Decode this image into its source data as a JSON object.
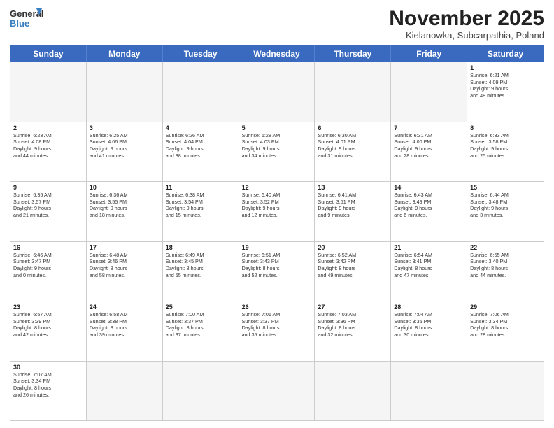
{
  "logo": {
    "line1": "General",
    "line2": "Blue"
  },
  "title": "November 2025",
  "subtitle": "Kielanowka, Subcarpathia, Poland",
  "header_days": [
    "Sunday",
    "Monday",
    "Tuesday",
    "Wednesday",
    "Thursday",
    "Friday",
    "Saturday"
  ],
  "weeks": [
    [
      {
        "day": "",
        "info": "",
        "empty": true
      },
      {
        "day": "",
        "info": "",
        "empty": true
      },
      {
        "day": "",
        "info": "",
        "empty": true
      },
      {
        "day": "",
        "info": "",
        "empty": true
      },
      {
        "day": "",
        "info": "",
        "empty": true
      },
      {
        "day": "",
        "info": "",
        "empty": true
      },
      {
        "day": "1",
        "info": "Sunrise: 6:21 AM\nSunset: 4:09 PM\nDaylight: 9 hours\nand 48 minutes.",
        "empty": false
      }
    ],
    [
      {
        "day": "2",
        "info": "Sunrise: 6:23 AM\nSunset: 4:08 PM\nDaylight: 9 hours\nand 44 minutes.",
        "empty": false
      },
      {
        "day": "3",
        "info": "Sunrise: 6:25 AM\nSunset: 4:06 PM\nDaylight: 9 hours\nand 41 minutes.",
        "empty": false
      },
      {
        "day": "4",
        "info": "Sunrise: 6:26 AM\nSunset: 4:04 PM\nDaylight: 9 hours\nand 38 minutes.",
        "empty": false
      },
      {
        "day": "5",
        "info": "Sunrise: 6:28 AM\nSunset: 4:03 PM\nDaylight: 9 hours\nand 34 minutes.",
        "empty": false
      },
      {
        "day": "6",
        "info": "Sunrise: 6:30 AM\nSunset: 4:01 PM\nDaylight: 9 hours\nand 31 minutes.",
        "empty": false
      },
      {
        "day": "7",
        "info": "Sunrise: 6:31 AM\nSunset: 4:00 PM\nDaylight: 9 hours\nand 28 minutes.",
        "empty": false
      },
      {
        "day": "8",
        "info": "Sunrise: 6:33 AM\nSunset: 3:58 PM\nDaylight: 9 hours\nand 25 minutes.",
        "empty": false
      }
    ],
    [
      {
        "day": "9",
        "info": "Sunrise: 6:35 AM\nSunset: 3:57 PM\nDaylight: 9 hours\nand 21 minutes.",
        "empty": false
      },
      {
        "day": "10",
        "info": "Sunrise: 6:36 AM\nSunset: 3:55 PM\nDaylight: 9 hours\nand 18 minutes.",
        "empty": false
      },
      {
        "day": "11",
        "info": "Sunrise: 6:38 AM\nSunset: 3:54 PM\nDaylight: 9 hours\nand 15 minutes.",
        "empty": false
      },
      {
        "day": "12",
        "info": "Sunrise: 6:40 AM\nSunset: 3:52 PM\nDaylight: 9 hours\nand 12 minutes.",
        "empty": false
      },
      {
        "day": "13",
        "info": "Sunrise: 6:41 AM\nSunset: 3:51 PM\nDaylight: 9 hours\nand 9 minutes.",
        "empty": false
      },
      {
        "day": "14",
        "info": "Sunrise: 6:43 AM\nSunset: 3:49 PM\nDaylight: 9 hours\nand 6 minutes.",
        "empty": false
      },
      {
        "day": "15",
        "info": "Sunrise: 6:44 AM\nSunset: 3:48 PM\nDaylight: 9 hours\nand 3 minutes.",
        "empty": false
      }
    ],
    [
      {
        "day": "16",
        "info": "Sunrise: 6:46 AM\nSunset: 3:47 PM\nDaylight: 9 hours\nand 0 minutes.",
        "empty": false
      },
      {
        "day": "17",
        "info": "Sunrise: 6:48 AM\nSunset: 3:46 PM\nDaylight: 8 hours\nand 58 minutes.",
        "empty": false
      },
      {
        "day": "18",
        "info": "Sunrise: 6:49 AM\nSunset: 3:45 PM\nDaylight: 8 hours\nand 55 minutes.",
        "empty": false
      },
      {
        "day": "19",
        "info": "Sunrise: 6:51 AM\nSunset: 3:43 PM\nDaylight: 8 hours\nand 52 minutes.",
        "empty": false
      },
      {
        "day": "20",
        "info": "Sunrise: 6:52 AM\nSunset: 3:42 PM\nDaylight: 8 hours\nand 49 minutes.",
        "empty": false
      },
      {
        "day": "21",
        "info": "Sunrise: 6:54 AM\nSunset: 3:41 PM\nDaylight: 8 hours\nand 47 minutes.",
        "empty": false
      },
      {
        "day": "22",
        "info": "Sunrise: 6:55 AM\nSunset: 3:40 PM\nDaylight: 8 hours\nand 44 minutes.",
        "empty": false
      }
    ],
    [
      {
        "day": "23",
        "info": "Sunrise: 6:57 AM\nSunset: 3:39 PM\nDaylight: 8 hours\nand 42 minutes.",
        "empty": false
      },
      {
        "day": "24",
        "info": "Sunrise: 6:58 AM\nSunset: 3:38 PM\nDaylight: 8 hours\nand 39 minutes.",
        "empty": false
      },
      {
        "day": "25",
        "info": "Sunrise: 7:00 AM\nSunset: 3:37 PM\nDaylight: 8 hours\nand 37 minutes.",
        "empty": false
      },
      {
        "day": "26",
        "info": "Sunrise: 7:01 AM\nSunset: 3:37 PM\nDaylight: 8 hours\nand 35 minutes.",
        "empty": false
      },
      {
        "day": "27",
        "info": "Sunrise: 7:03 AM\nSunset: 3:36 PM\nDaylight: 8 hours\nand 32 minutes.",
        "empty": false
      },
      {
        "day": "28",
        "info": "Sunrise: 7:04 AM\nSunset: 3:35 PM\nDaylight: 8 hours\nand 30 minutes.",
        "empty": false
      },
      {
        "day": "29",
        "info": "Sunrise: 7:06 AM\nSunset: 3:34 PM\nDaylight: 8 hours\nand 28 minutes.",
        "empty": false
      }
    ],
    [
      {
        "day": "30",
        "info": "Sunrise: 7:07 AM\nSunset: 3:34 PM\nDaylight: 8 hours\nand 26 minutes.",
        "empty": false
      },
      {
        "day": "",
        "info": "",
        "empty": true
      },
      {
        "day": "",
        "info": "",
        "empty": true
      },
      {
        "day": "",
        "info": "",
        "empty": true
      },
      {
        "day": "",
        "info": "",
        "empty": true
      },
      {
        "day": "",
        "info": "",
        "empty": true
      },
      {
        "day": "",
        "info": "",
        "empty": true
      }
    ]
  ]
}
